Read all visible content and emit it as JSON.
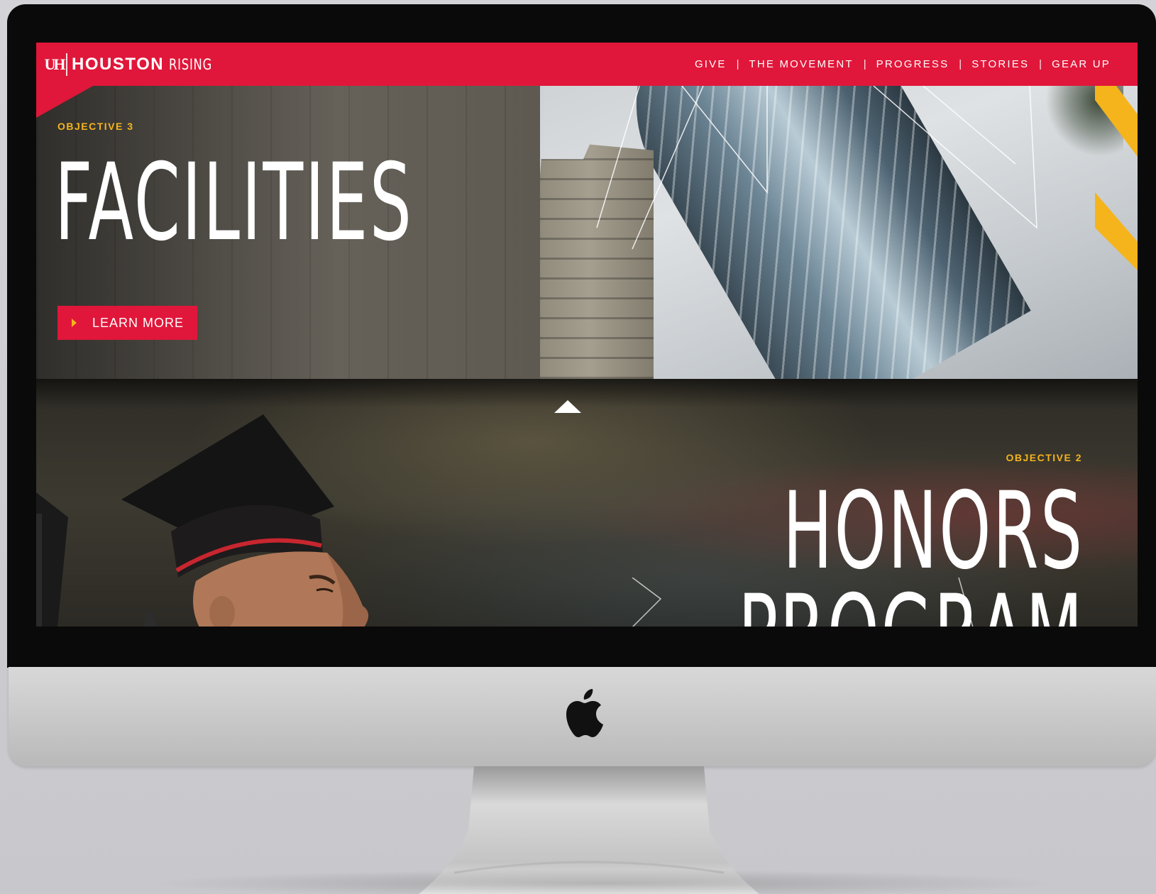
{
  "nav": {
    "logo_mark": "UH",
    "logo_houston": "HOUSTON",
    "logo_rising": "RISING",
    "links": [
      "GIVE",
      "THE MOVEMENT",
      "PROGRESS",
      "STORIES",
      "GEAR UP"
    ],
    "separator": "|"
  },
  "hero_facilities": {
    "eyebrow": "OBJECTIVE 3",
    "title": "FACILITIES",
    "button_label": "LEARN MORE"
  },
  "hero_honors": {
    "eyebrow": "OBJECTIVE 2",
    "title_line1": "HONORS",
    "title_line2": "PROGRAM"
  },
  "colors": {
    "brand_red": "#e0173a",
    "accent_gold": "#f5b41c",
    "text_white": "#ffffff"
  },
  "icons": {
    "scroll_up": "up-triangle-icon",
    "button_arrow": "play-arrow-icon",
    "device_logo": "apple-icon"
  }
}
